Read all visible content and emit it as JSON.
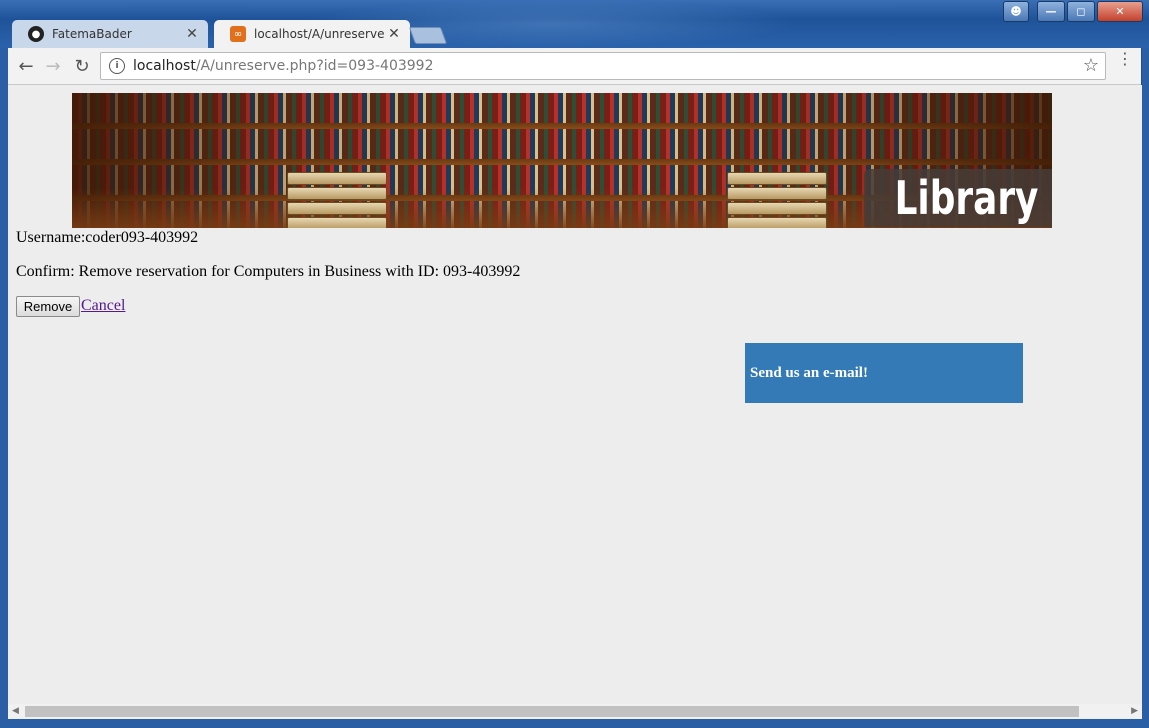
{
  "browser": {
    "tabs": [
      {
        "label": "FatemaBader",
        "favicon": "github-icon"
      },
      {
        "label": "localhost/A/unreserve.ph",
        "favicon": "xampp-icon"
      }
    ],
    "address": {
      "host": "localhost",
      "path": "/A/unreserve.php?id=093-403992"
    }
  },
  "banner": {
    "title": "Library"
  },
  "page": {
    "username_line": "Username:coder093-403992",
    "confirm_line": "Confirm: Remove reservation for Computers in Business with ID: 093-403992",
    "remove_label": "Remove",
    "cancel_label": "Cancel",
    "email_label": "Send us an e-mail!"
  },
  "colors": {
    "email_box": "#337ab7",
    "link_visited": "#551a8b",
    "page_bg": "#ededed"
  }
}
